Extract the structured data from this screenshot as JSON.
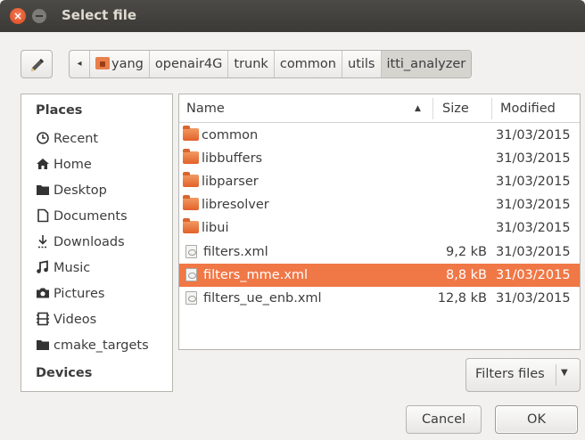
{
  "window": {
    "title": "Select file"
  },
  "breadcrumb": [
    "yang",
    "openair4G",
    "trunk",
    "common",
    "utils",
    "itti_analyzer"
  ],
  "places": {
    "heading": "Places",
    "items": [
      "Recent",
      "Home",
      "Desktop",
      "Documents",
      "Downloads",
      "Music",
      "Pictures",
      "Videos",
      "cmake_targets"
    ],
    "devices_heading": "Devices"
  },
  "columns": {
    "name": "Name",
    "size": "Size",
    "modified": "Modified"
  },
  "files": [
    {
      "name": "common",
      "type": "folder",
      "size": "",
      "modified": "31/03/2015"
    },
    {
      "name": "libbuffers",
      "type": "folder",
      "size": "",
      "modified": "31/03/2015"
    },
    {
      "name": "libparser",
      "type": "folder",
      "size": "",
      "modified": "31/03/2015"
    },
    {
      "name": "libresolver",
      "type": "folder",
      "size": "",
      "modified": "31/03/2015"
    },
    {
      "name": "libui",
      "type": "folder",
      "size": "",
      "modified": "31/03/2015"
    },
    {
      "name": "filters.xml",
      "type": "file",
      "size": "9,2 kB",
      "modified": "31/03/2015"
    },
    {
      "name": "filters_mme.xml",
      "type": "file",
      "size": "8,8 kB",
      "modified": "31/03/2015",
      "selected": true
    },
    {
      "name": "filters_ue_enb.xml",
      "type": "file",
      "size": "12,8 kB",
      "modified": "31/03/2015"
    }
  ],
  "filter": {
    "label": "Filters files"
  },
  "buttons": {
    "cancel": "Cancel",
    "ok": "OK"
  },
  "colors": {
    "accent": "#f07746",
    "titlebar": "#3c3b37",
    "folder": "#e8733b"
  }
}
